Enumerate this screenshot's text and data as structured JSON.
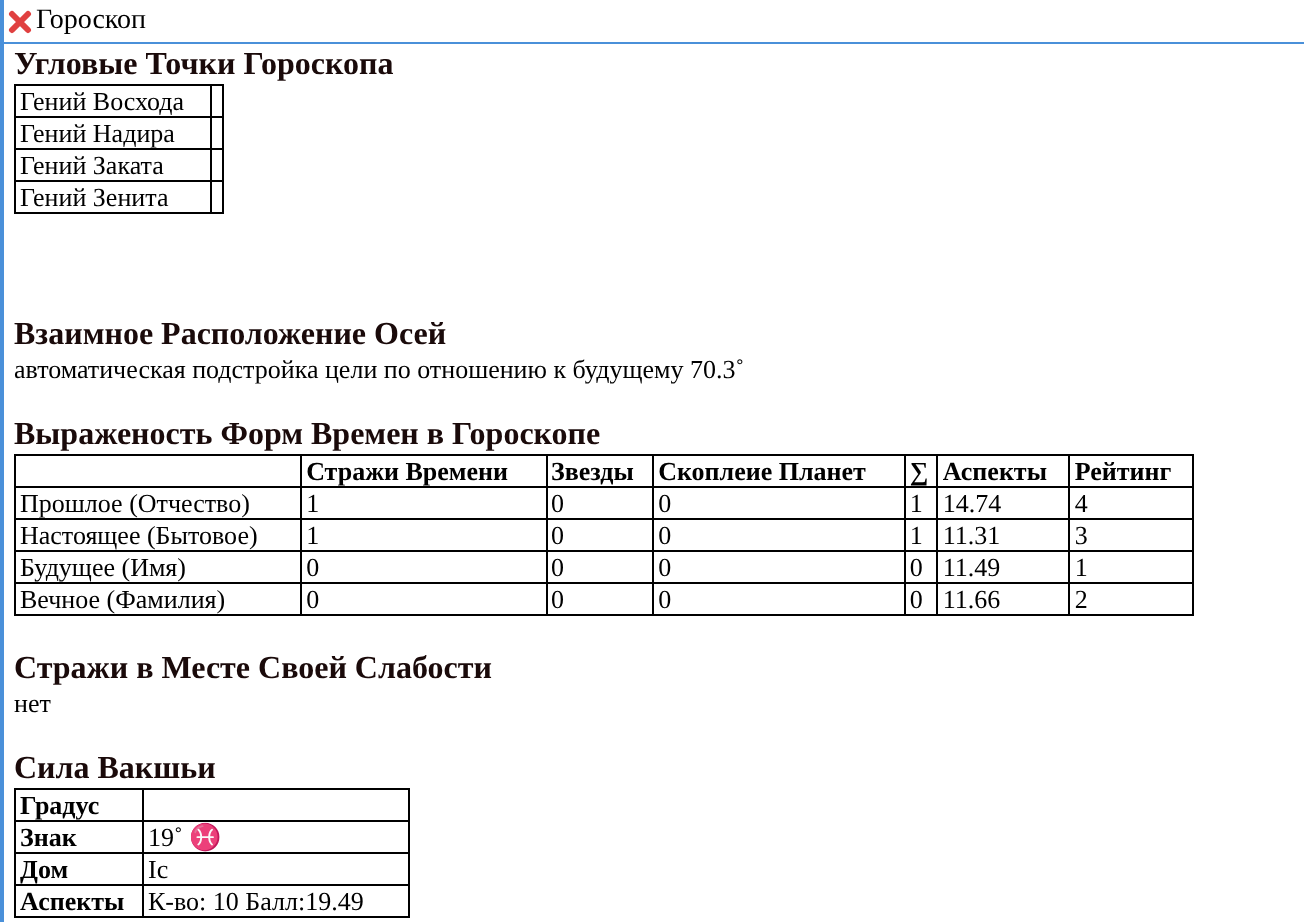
{
  "window": {
    "title": "Гороскоп"
  },
  "angular_points": {
    "title": "Угловые Точки Гороскопа",
    "rows": [
      "Гений Восхода",
      "Гений Надира",
      "Гений Заката",
      "Гений Зенита"
    ]
  },
  "axes": {
    "title": "Взаимное Расположение Осей",
    "text": "автоматическая подстройка цели по отношению к будущему 70.3˚"
  },
  "time_forms": {
    "title": "Выраженость Форм Времен в Гороскопе",
    "columns": [
      "Стражи Времени",
      "Звезды",
      "Скоплеие Планет",
      "∑",
      "Аспекты",
      "Рейтинг"
    ],
    "rows": [
      {
        "label": "Прошлое (Отчество)",
        "cells": [
          "1",
          "0",
          "0",
          "1",
          "14.74",
          "4"
        ]
      },
      {
        "label": "Настоящее (Бытовое)",
        "cells": [
          "1",
          "0",
          "0",
          "1",
          "11.31",
          "3"
        ]
      },
      {
        "label": "Будущее (Имя)",
        "cells": [
          "0",
          "0",
          "0",
          "0",
          "11.49",
          "1"
        ]
      },
      {
        "label": "Вечное (Фамилия)",
        "cells": [
          "0",
          "0",
          "0",
          "0",
          "11.66",
          "2"
        ]
      }
    ]
  },
  "weak_guardians": {
    "title": "Стражи в Месте Своей Слабости",
    "text": "нет"
  },
  "vakshya": {
    "title": "Сила Вакшьи",
    "rows": [
      {
        "label": "Градус"
      },
      {
        "label": "Знак",
        "value": "19˚ ♓"
      },
      {
        "label": "Дом",
        "value": "Ic"
      },
      {
        "label": "Аспекты",
        "value": "К-во: 10 Балл:19.49"
      }
    ]
  }
}
